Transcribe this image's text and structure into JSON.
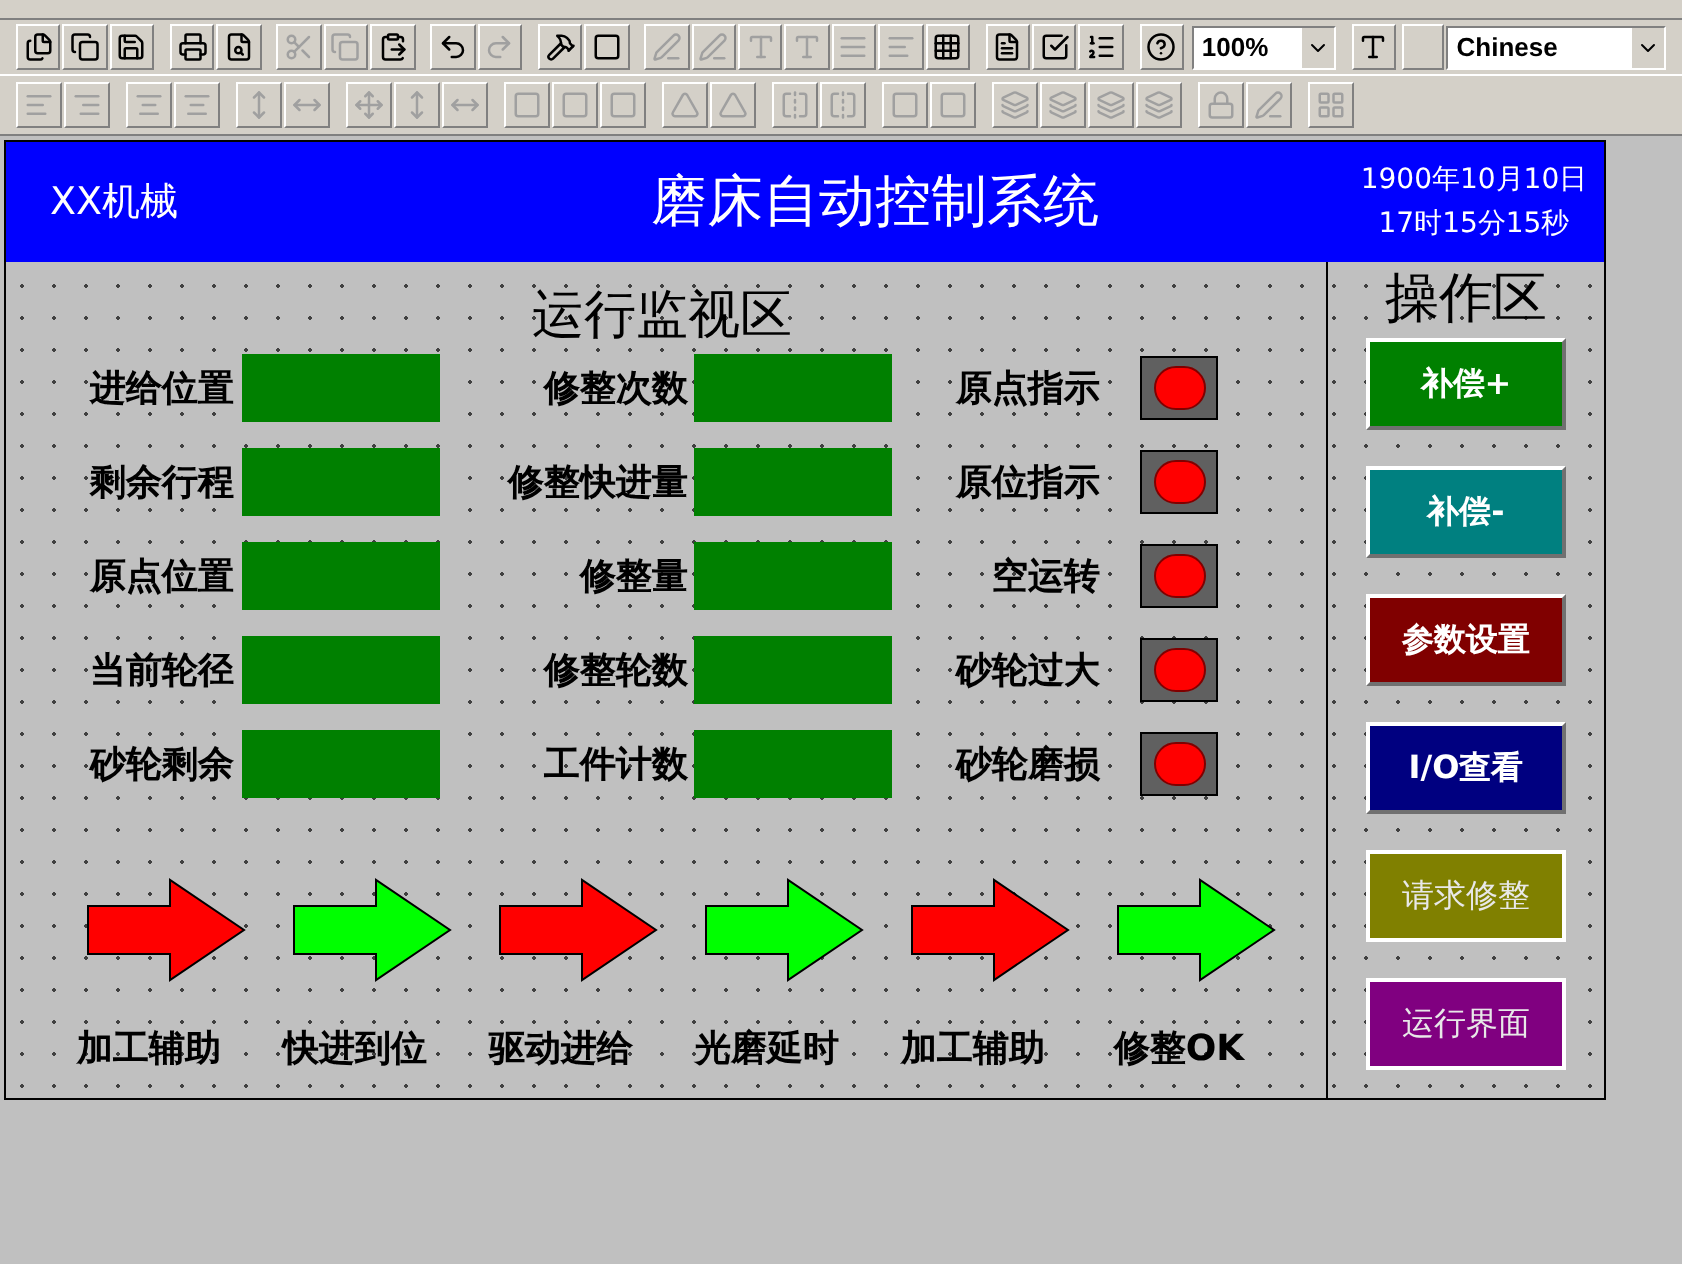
{
  "toolbar": {
    "zoom": "100%",
    "language": "Chinese"
  },
  "header": {
    "company": "XX机械",
    "title": "磨床自动控制系统",
    "date": "1900年10月10日",
    "time": "17时15分15秒"
  },
  "monitor": {
    "title": "运行监视区",
    "rows": [
      {
        "label1": "进给位置",
        "label2": "修整次数",
        "label3": "原点指示"
      },
      {
        "label1": "剩余行程",
        "label2": "修整快进量",
        "label3": "原位指示"
      },
      {
        "label1": "原点位置",
        "label2": "修整量",
        "label3": "空运转"
      },
      {
        "label1": "当前轮径",
        "label2": "修整轮数",
        "label3": "砂轮过大"
      },
      {
        "label1": "砂轮剩余",
        "label2": "工件计数",
        "label3": "砂轮磨损"
      }
    ],
    "arrows": [
      {
        "label": "加工辅助",
        "color": "#ff0000"
      },
      {
        "label": "快进到位",
        "color": "#00ff00"
      },
      {
        "label": "驱动进给",
        "color": "#ff0000"
      },
      {
        "label": "光磨延时",
        "color": "#00ff00"
      },
      {
        "label": "加工辅助",
        "color": "#ff0000"
      },
      {
        "label": "修整OK",
        "color": "#00ff00"
      }
    ]
  },
  "operations": {
    "title": "操作区",
    "buttons": [
      {
        "label": "补偿+",
        "color": "#008000",
        "kind": "raised"
      },
      {
        "label": "补偿-",
        "color": "#008080",
        "kind": "raised"
      },
      {
        "label": "参数设置",
        "color": "#800000",
        "kind": "raised"
      },
      {
        "label": "I/O查看",
        "color": "#000080",
        "kind": "raised"
      },
      {
        "label": "请求修整",
        "color": "#808000",
        "kind": "framed"
      },
      {
        "label": "运行界面",
        "color": "#800080",
        "kind": "framed"
      }
    ]
  }
}
